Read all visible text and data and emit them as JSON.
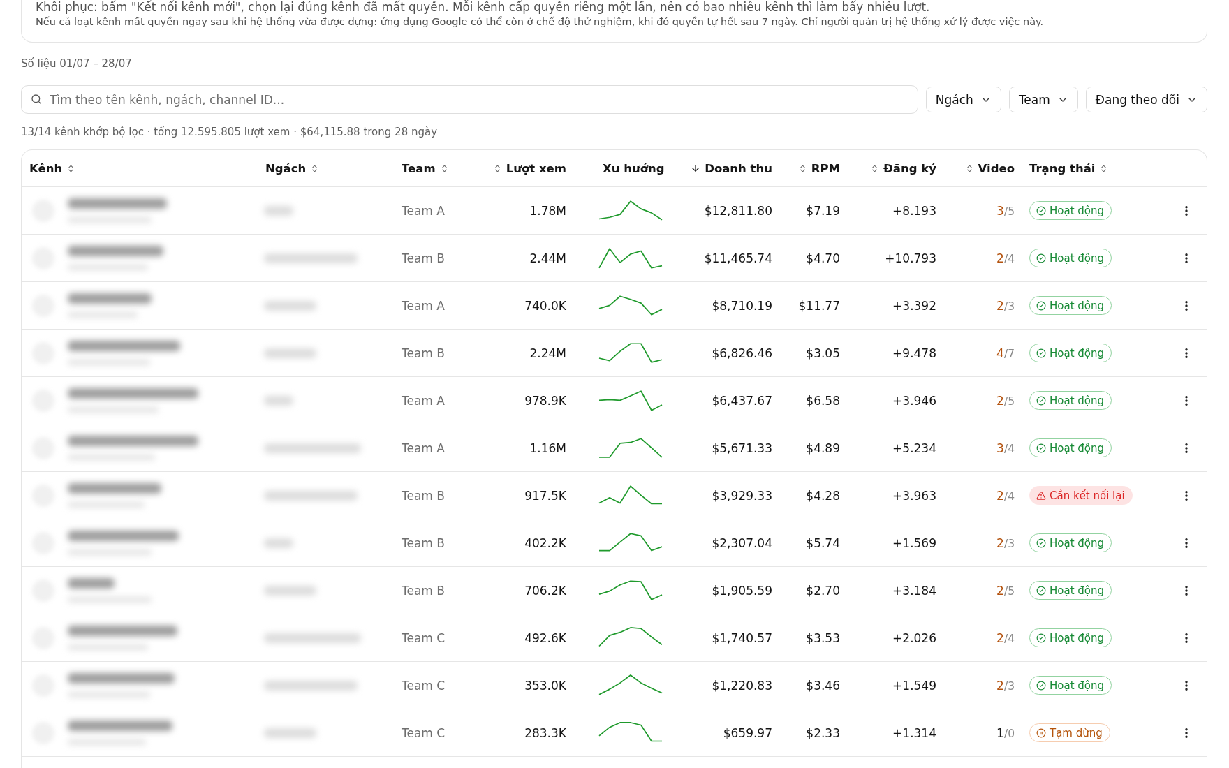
{
  "notice": {
    "lines": [
      "Khôi phục: bấm \"Kết nối kênh mới\", chọn lại đúng kênh đã mất quyền. Mỗi kênh cấp quyền riêng một lần, nên có bao nhiêu kênh thì làm bấy nhiêu lượt.",
      "Nếu cả loạt kênh mất quyền ngay sau khi hệ thống vừa được dựng: ứng dụng Google có thể còn ở chế độ thử nghiệm, khi đó quyền tự hết sau 7 ngày. Chỉ người quản trị hệ thống xử lý được việc này."
    ]
  },
  "period": "Số liệu 01/07 – 28/07",
  "search": {
    "placeholder": "Tìm theo tên kênh, ngách, channel ID..."
  },
  "filters": [
    {
      "label": "Ngách"
    },
    {
      "label": "Team"
    },
    {
      "label": "Đang theo dõi"
    }
  ],
  "summary": "13/14 kênh khớp bộ lọc · tổng 12.595.805 lượt xem · $64,115.88 trong 28 ngày",
  "table": {
    "columns": [
      {
        "label": "Kênh",
        "sortable": true,
        "sorted": false
      },
      {
        "label": "Ngách",
        "sortable": true,
        "sorted": false
      },
      {
        "label": "Team",
        "sortable": true,
        "sorted": false
      },
      {
        "label": "Lượt xem",
        "sortable": true,
        "sorted": false
      },
      {
        "label": "Xu hướng",
        "sortable": false,
        "sorted": false
      },
      {
        "label": "Doanh thu",
        "sortable": true,
        "sorted": true
      },
      {
        "label": "RPM",
        "sortable": true,
        "sorted": false
      },
      {
        "label": "Đăng ký",
        "sortable": true,
        "sorted": false
      },
      {
        "label": "Video",
        "sortable": true,
        "sorted": false
      },
      {
        "label": "Trạng thái",
        "sortable": true,
        "sorted": false
      }
    ],
    "rows": [
      {
        "team": "Team A",
        "views": "1.78M",
        "revenue": "$12,811.80",
        "rpm": "$7.19",
        "subscribers": "+8.193",
        "videos": {
          "done": "3",
          "of": "/5",
          "behind": true
        },
        "status": {
          "kind": "active",
          "label": "Hoạt động"
        }
      },
      {
        "team": "Team B",
        "views": "2.44M",
        "revenue": "$11,465.74",
        "rpm": "$4.70",
        "subscribers": "+10.793",
        "videos": {
          "done": "2",
          "of": "/4",
          "behind": true
        },
        "status": {
          "kind": "active",
          "label": "Hoạt động"
        }
      },
      {
        "team": "Team A",
        "views": "740.0K",
        "revenue": "$8,710.19",
        "rpm": "$11.77",
        "subscribers": "+3.392",
        "videos": {
          "done": "2",
          "of": "/3",
          "behind": true
        },
        "status": {
          "kind": "active",
          "label": "Hoạt động"
        }
      },
      {
        "team": "Team B",
        "views": "2.24M",
        "revenue": "$6,826.46",
        "rpm": "$3.05",
        "subscribers": "+9.478",
        "videos": {
          "done": "4",
          "of": "/7",
          "behind": true
        },
        "status": {
          "kind": "active",
          "label": "Hoạt động"
        }
      },
      {
        "team": "Team A",
        "views": "978.9K",
        "revenue": "$6,437.67",
        "rpm": "$6.58",
        "subscribers": "+3.946",
        "videos": {
          "done": "2",
          "of": "/5",
          "behind": true
        },
        "status": {
          "kind": "active",
          "label": "Hoạt động"
        }
      },
      {
        "team": "Team A",
        "views": "1.16M",
        "revenue": "$5,671.33",
        "rpm": "$4.89",
        "subscribers": "+5.234",
        "videos": {
          "done": "3",
          "of": "/4",
          "behind": true
        },
        "status": {
          "kind": "active",
          "label": "Hoạt động"
        }
      },
      {
        "team": "Team B",
        "views": "917.5K",
        "revenue": "$3,929.33",
        "rpm": "$4.28",
        "subscribers": "+3.963",
        "videos": {
          "done": "2",
          "of": "/4",
          "behind": true
        },
        "status": {
          "kind": "reconnect",
          "label": "Cần kết nối lại"
        }
      },
      {
        "team": "Team B",
        "views": "402.2K",
        "revenue": "$2,307.04",
        "rpm": "$5.74",
        "subscribers": "+1.569",
        "videos": {
          "done": "2",
          "of": "/3",
          "behind": true
        },
        "status": {
          "kind": "active",
          "label": "Hoạt động"
        }
      },
      {
        "team": "Team B",
        "views": "706.2K",
        "revenue": "$1,905.59",
        "rpm": "$2.70",
        "subscribers": "+3.184",
        "videos": {
          "done": "2",
          "of": "/5",
          "behind": true
        },
        "status": {
          "kind": "active",
          "label": "Hoạt động"
        }
      },
      {
        "team": "Team C",
        "views": "492.6K",
        "revenue": "$1,740.57",
        "rpm": "$3.53",
        "subscribers": "+2.026",
        "videos": {
          "done": "2",
          "of": "/4",
          "behind": true
        },
        "status": {
          "kind": "active",
          "label": "Hoạt động"
        }
      },
      {
        "team": "Team C",
        "views": "353.0K",
        "revenue": "$1,220.83",
        "rpm": "$3.46",
        "subscribers": "+1.549",
        "videos": {
          "done": "2",
          "of": "/3",
          "behind": true
        },
        "status": {
          "kind": "active",
          "label": "Hoạt động"
        }
      },
      {
        "team": "Team C",
        "views": "283.3K",
        "revenue": "$659.97",
        "rpm": "$2.33",
        "subscribers": "+1.314",
        "videos": {
          "done": "1",
          "of": "/0",
          "behind": false
        },
        "status": {
          "kind": "paused",
          "label": "Tạm dừng"
        }
      }
    ]
  }
}
